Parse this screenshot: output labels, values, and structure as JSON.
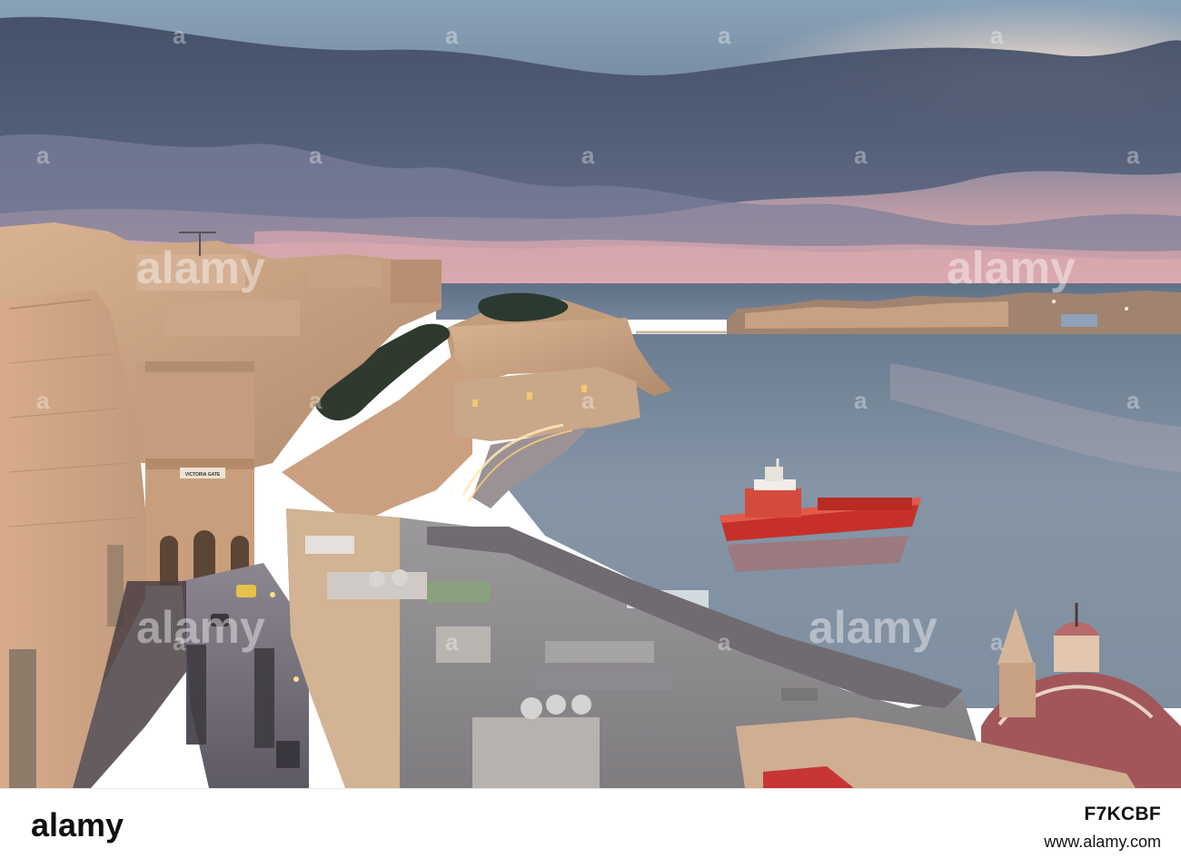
{
  "watermark": {
    "text": "alamy",
    "mark": "a"
  },
  "sign": {
    "text": "VICTORIA GATE"
  },
  "footer": {
    "logo_text": "alamy",
    "image_id": "F7KCBF",
    "url": "www.alamy.com"
  }
}
